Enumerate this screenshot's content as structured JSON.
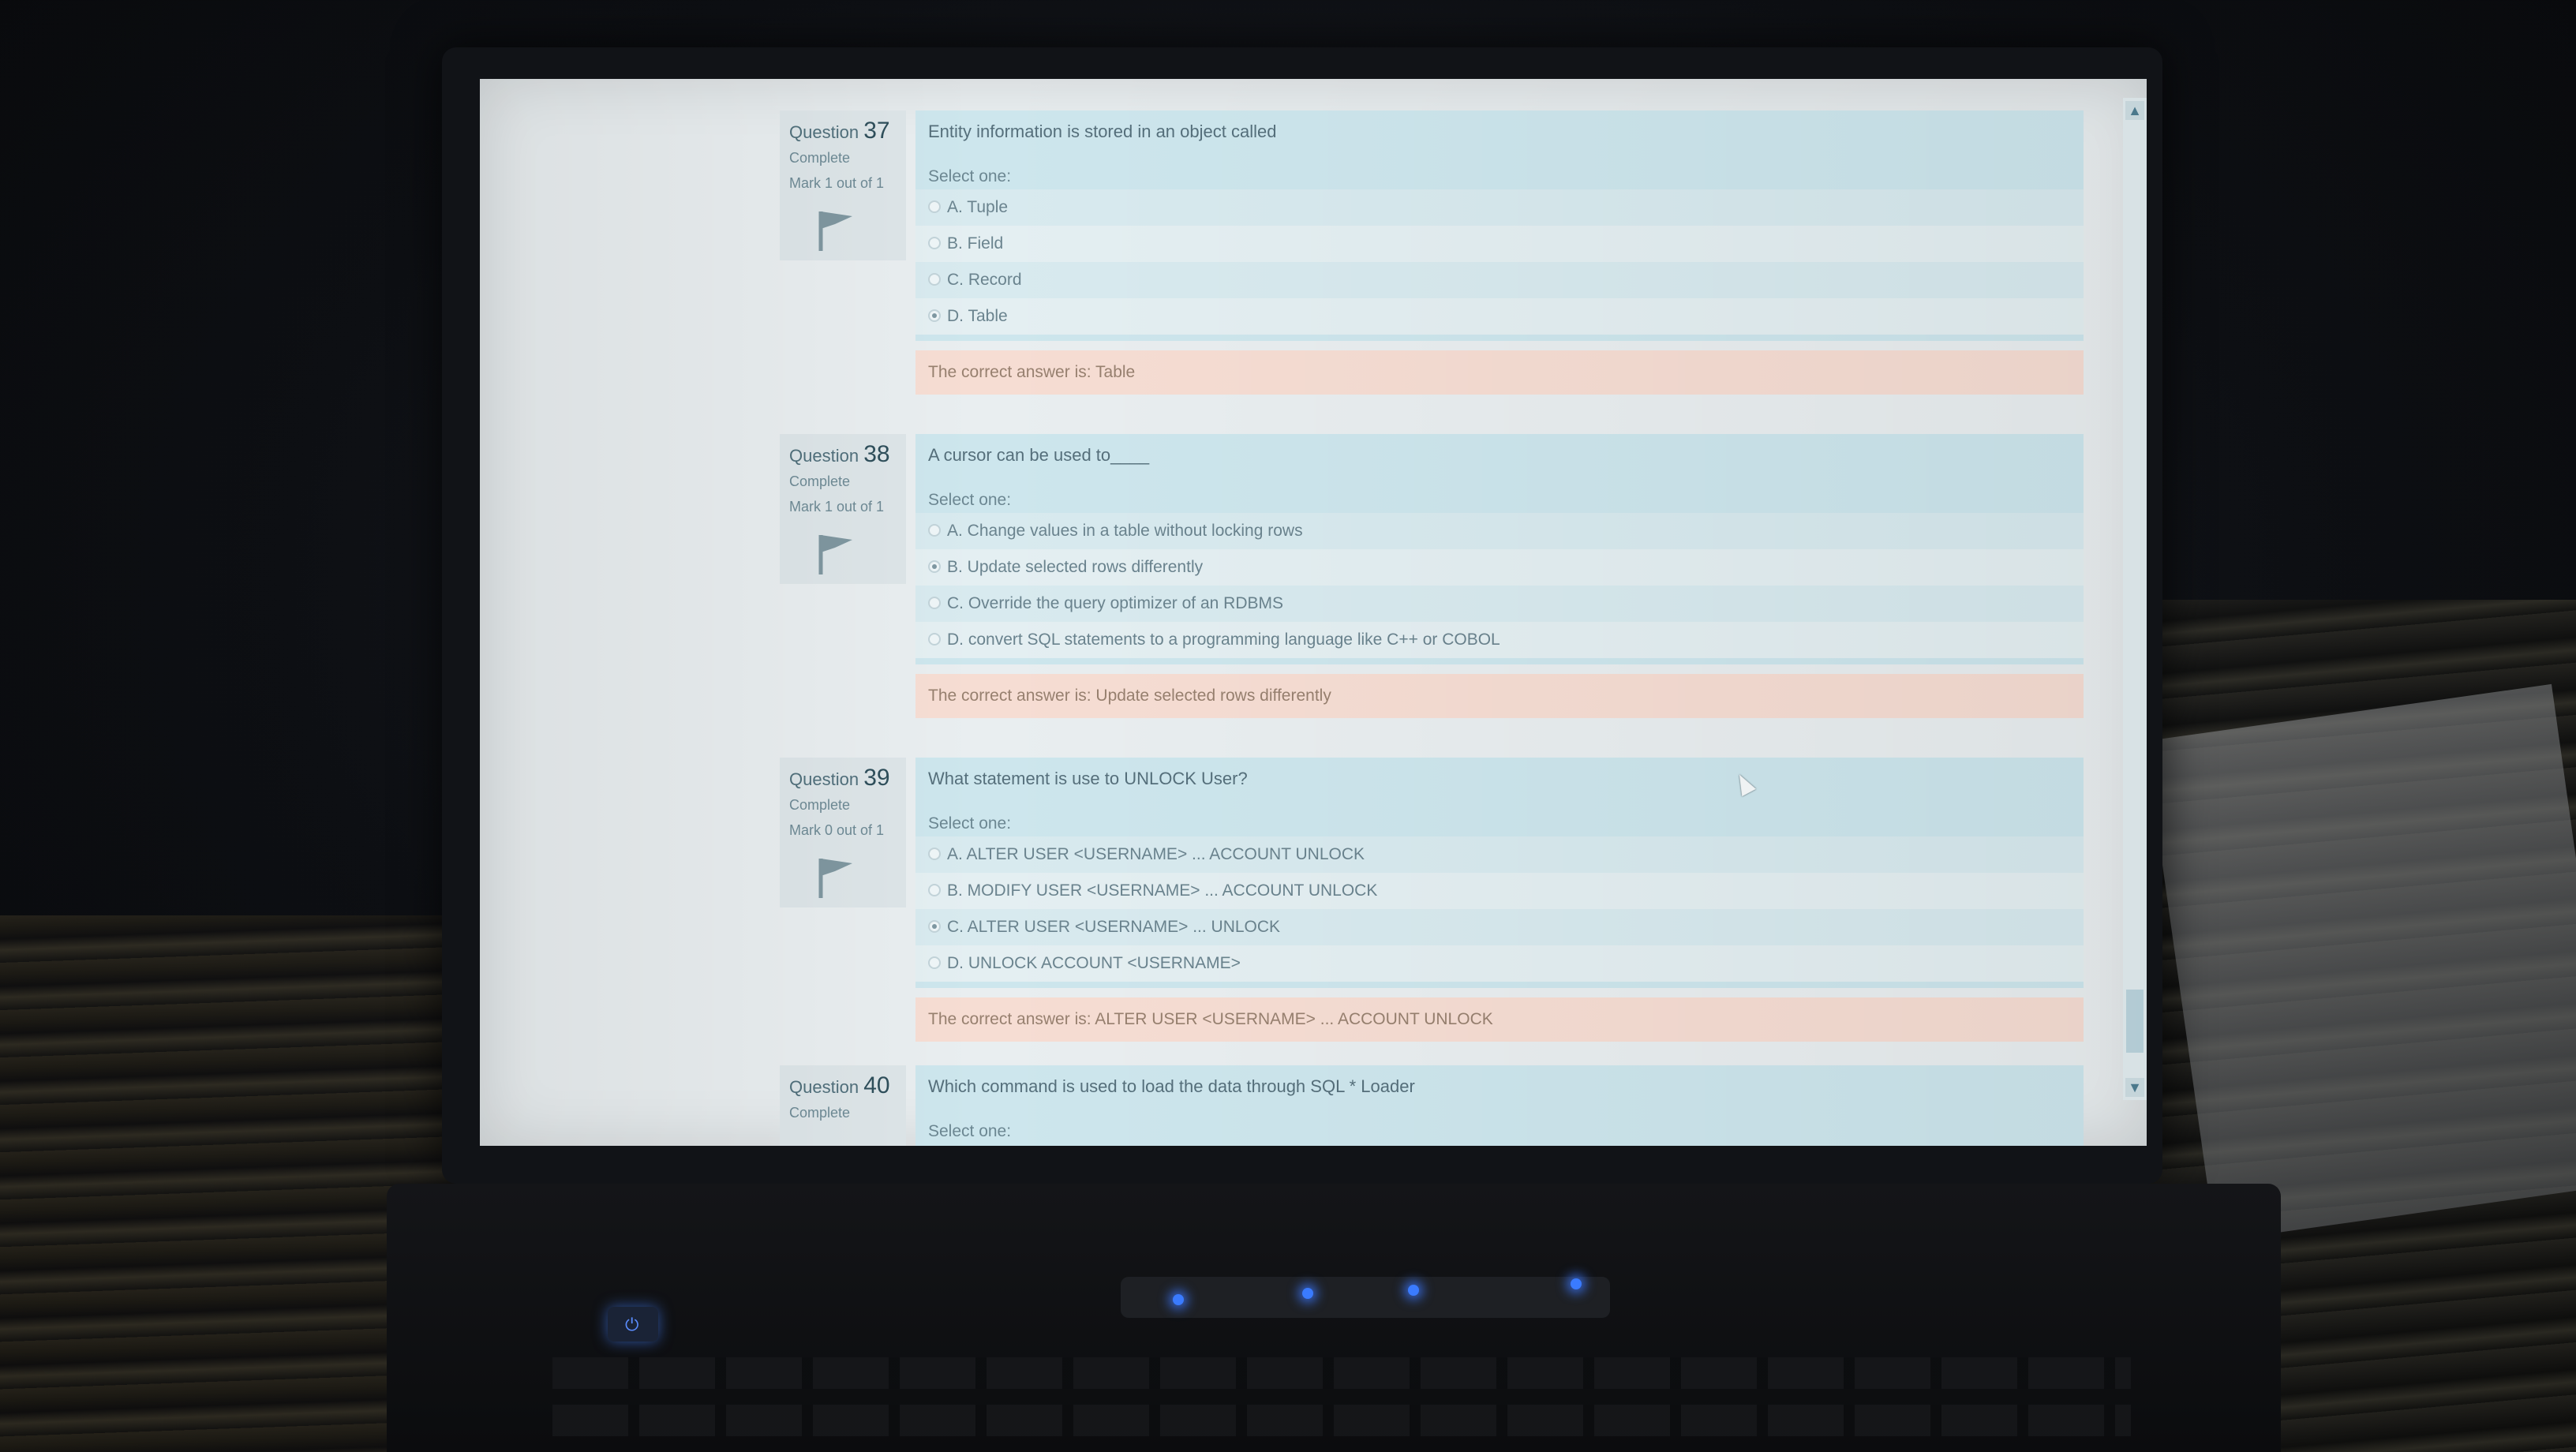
{
  "questions": [
    {
      "label": "Question",
      "number": "37",
      "state": "Complete",
      "mark": "Mark 1 out of 1",
      "text": "Entity information is stored in an object called",
      "prompt": "Select one:",
      "options": [
        "A. Tuple",
        "B. Field",
        "C. Record",
        "D. Table"
      ],
      "selected": "D",
      "feedback": "The correct answer is: Table"
    },
    {
      "label": "Question",
      "number": "38",
      "state": "Complete",
      "mark": "Mark 1 out of 1",
      "text": "A cursor can be used to____",
      "prompt": "Select one:",
      "options": [
        "A. Change values in a table without locking rows",
        "B. Update selected rows differently",
        "C. Override the query optimizer of an RDBMS",
        "D. convert SQL statements to a programming language like C++ or COBOL"
      ],
      "selected": "B",
      "feedback": "The correct answer is: Update selected rows differently"
    },
    {
      "label": "Question",
      "number": "39",
      "state": "Complete",
      "mark": "Mark 0 out of 1",
      "text": "What statement is use to UNLOCK User?",
      "prompt": "Select one:",
      "options": [
        "A. ALTER USER <USERNAME> ... ACCOUNT UNLOCK",
        "B. MODIFY USER <USERNAME> ... ACCOUNT UNLOCK",
        "C. ALTER USER <USERNAME> ... UNLOCK",
        "D. UNLOCK ACCOUNT <USERNAME>"
      ],
      "selected": "C",
      "feedback": "The correct answer is: ALTER USER <USERNAME> ... ACCOUNT UNLOCK"
    },
    {
      "label": "Question",
      "number": "40",
      "state": "Complete",
      "text": "Which command is used to load the data through SQL * Loader",
      "prompt": "Select one:"
    }
  ],
  "colors": {
    "question_bg": "#cde6ed",
    "feedback_bg": "#f6ddd3",
    "info_bg": "#dde5e8"
  },
  "icons": {
    "flag": "flag-icon",
    "scroll_up": "chevron-up-icon",
    "scroll_down": "chevron-down-icon",
    "cursor": "mouse-pointer-icon"
  }
}
